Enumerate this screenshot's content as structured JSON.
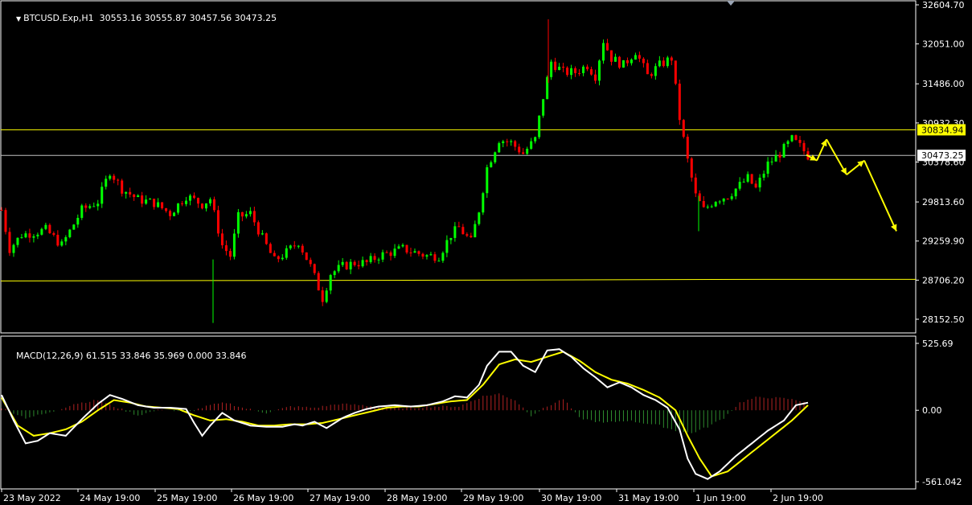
{
  "header": {
    "symbol_line": "BTCUSD.Exp,H1  30553.16 30555.87 30457.56 30473.25",
    "macd_line": "MACD(12,26,9) 61.515 33.846 35.969 0.000 33.846"
  },
  "colors": {
    "background": "#000000",
    "bull": "#00ff00",
    "bear": "#ff0000",
    "level_line": "#ffff00",
    "bid_line": "#c0c0c0",
    "macd_main": "#ffffff",
    "macd_signal": "#ffff00",
    "hist_pos": "#b22222",
    "hist_neg": "#2e8b2e",
    "forecast_arrow": "#ffff00"
  },
  "chart_data": [
    {
      "type": "candlestick",
      "symbol": "BTCUSD.Exp",
      "timeframe": "H1",
      "ohlc_last": {
        "open": 30553.16,
        "high": 30555.87,
        "low": 30457.56,
        "close": 30473.25
      },
      "y_ticks": [
        32604.7,
        32051.0,
        31486.0,
        30932.3,
        30378.6,
        29813.6,
        29259.9,
        28706.2,
        28152.5
      ],
      "ylim": [
        28050,
        32604.7
      ],
      "x_ticks": [
        "23 May 2022",
        "24 May 19:00",
        "25 May 19:00",
        "26 May 19:00",
        "27 May 19:00",
        "28 May 19:00",
        "29 May 19:00",
        "30 May 19:00",
        "31 May 19:00",
        "1 Jun 19:00",
        "2 Jun 19:00"
      ],
      "price_tags": [
        {
          "value": 30834.94,
          "label": "30834.94",
          "kind": "horizontal-level"
        },
        {
          "value": 30473.25,
          "label": "30473.25",
          "kind": "bid"
        }
      ],
      "support_line": 28706.2,
      "close_path": [
        [
          0,
          29700
        ],
        [
          2,
          29150
        ],
        [
          5,
          29350
        ],
        [
          8,
          29380
        ],
        [
          11,
          29420
        ],
        [
          15,
          29200
        ],
        [
          20,
          29700
        ],
        [
          24,
          29820
        ],
        [
          27,
          30250
        ],
        [
          30,
          30000
        ],
        [
          34,
          29850
        ],
        [
          38,
          29800
        ],
        [
          42,
          29650
        ],
        [
          46,
          29900
        ],
        [
          50,
          29780
        ],
        [
          52,
          29860
        ],
        [
          55,
          29200
        ],
        [
          57,
          29050
        ],
        [
          59,
          29600
        ],
        [
          62,
          29650
        ],
        [
          65,
          29300
        ],
        [
          68,
          28980
        ],
        [
          71,
          29100
        ],
        [
          74,
          29250
        ],
        [
          77,
          28900
        ],
        [
          80,
          28450
        ],
        [
          82,
          28800
        ],
        [
          85,
          28900
        ],
        [
          88,
          28950
        ],
        [
          91,
          28950
        ],
        [
          94,
          29050
        ],
        [
          97,
          29100
        ],
        [
          100,
          29150
        ],
        [
          103,
          29100
        ],
        [
          106,
          29050
        ],
        [
          109,
          29050
        ],
        [
          112,
          29350
        ],
        [
          114,
          29450
        ],
        [
          117,
          29250
        ],
        [
          119,
          29700
        ],
        [
          121,
          30300
        ],
        [
          124,
          30700
        ],
        [
          127,
          30650
        ],
        [
          130,
          30500
        ],
        [
          133,
          30700
        ],
        [
          135,
          31300
        ],
        [
          137,
          31800
        ],
        [
          140,
          31650
        ],
        [
          143,
          31650
        ],
        [
          146,
          31750
        ],
        [
          148,
          31600
        ],
        [
          150,
          32100
        ],
        [
          152,
          31850
        ],
        [
          155,
          31750
        ],
        [
          158,
          31950
        ],
        [
          161,
          31600
        ],
        [
          164,
          31750
        ],
        [
          167,
          31850
        ],
        [
          169,
          31000
        ],
        [
          171,
          30400
        ],
        [
          173,
          29900
        ],
        [
          175,
          29700
        ],
        [
          178,
          29850
        ],
        [
          181,
          29900
        ],
        [
          184,
          30050
        ],
        [
          186,
          30150
        ],
        [
          188,
          30000
        ],
        [
          191,
          30350
        ],
        [
          194,
          30500
        ],
        [
          197,
          30700
        ],
        [
          199,
          30600
        ],
        [
          201,
          30470
        ]
      ],
      "forecast_path": [
        [
          30480,
          30400
        ],
        [
          30500,
          30700
        ],
        [
          30550,
          30200
        ],
        [
          30600,
          30400
        ],
        [
          30640,
          29400
        ]
      ]
    },
    {
      "type": "macd",
      "name": "MACD(12,26,9)",
      "values": {
        "main": 61.515,
        "signal": 33.846,
        "histogram": 35.969,
        "extra1": 0.0,
        "extra2": 33.846
      },
      "y_ticks": [
        525.69,
        0.0,
        -561.042
      ],
      "ylim": [
        -561.042,
        525.69
      ],
      "main_path": [
        [
          0,
          120
        ],
        [
          3,
          -80
        ],
        [
          6,
          -260
        ],
        [
          9,
          -240
        ],
        [
          12,
          -180
        ],
        [
          16,
          -200
        ],
        [
          20,
          -70
        ],
        [
          24,
          50
        ],
        [
          27,
          120
        ],
        [
          30,
          90
        ],
        [
          34,
          40
        ],
        [
          38,
          20
        ],
        [
          42,
          20
        ],
        [
          46,
          10
        ],
        [
          48,
          -100
        ],
        [
          50,
          -200
        ],
        [
          52,
          -120
        ],
        [
          55,
          -20
        ],
        [
          58,
          -80
        ],
        [
          62,
          -120
        ],
        [
          66,
          -130
        ],
        [
          70,
          -130
        ],
        [
          73,
          -110
        ],
        [
          75,
          -120
        ],
        [
          78,
          -90
        ],
        [
          81,
          -140
        ],
        [
          85,
          -60
        ],
        [
          88,
          -20
        ],
        [
          91,
          10
        ],
        [
          94,
          30
        ],
        [
          98,
          40
        ],
        [
          102,
          30
        ],
        [
          106,
          40
        ],
        [
          110,
          70
        ],
        [
          113,
          110
        ],
        [
          116,
          100
        ],
        [
          119,
          200
        ],
        [
          121,
          350
        ],
        [
          124,
          460
        ],
        [
          127,
          460
        ],
        [
          130,
          350
        ],
        [
          133,
          300
        ],
        [
          136,
          470
        ],
        [
          139,
          480
        ],
        [
          142,
          420
        ],
        [
          145,
          330
        ],
        [
          148,
          260
        ],
        [
          151,
          180
        ],
        [
          154,
          220
        ],
        [
          157,
          180
        ],
        [
          160,
          120
        ],
        [
          163,
          80
        ],
        [
          166,
          20
        ],
        [
          169,
          -150
        ],
        [
          171,
          -380
        ],
        [
          173,
          -500
        ],
        [
          176,
          -540
        ],
        [
          179,
          -480
        ],
        [
          183,
          -360
        ],
        [
          187,
          -260
        ],
        [
          191,
          -160
        ],
        [
          195,
          -80
        ],
        [
          198,
          40
        ],
        [
          201,
          60
        ]
      ],
      "signal_path": [
        [
          0,
          100
        ],
        [
          4,
          -120
        ],
        [
          8,
          -200
        ],
        [
          12,
          -180
        ],
        [
          16,
          -150
        ],
        [
          20,
          -90
        ],
        [
          24,
          0
        ],
        [
          28,
          80
        ],
        [
          32,
          60
        ],
        [
          36,
          30
        ],
        [
          40,
          20
        ],
        [
          44,
          10
        ],
        [
          48,
          -40
        ],
        [
          52,
          -80
        ],
        [
          56,
          -70
        ],
        [
          60,
          -90
        ],
        [
          64,
          -120
        ],
        [
          68,
          -120
        ],
        [
          72,
          -110
        ],
        [
          76,
          -110
        ],
        [
          80,
          -100
        ],
        [
          84,
          -70
        ],
        [
          88,
          -40
        ],
        [
          92,
          -10
        ],
        [
          96,
          20
        ],
        [
          100,
          30
        ],
        [
          104,
          30
        ],
        [
          108,
          50
        ],
        [
          112,
          70
        ],
        [
          116,
          80
        ],
        [
          120,
          200
        ],
        [
          124,
          360
        ],
        [
          128,
          400
        ],
        [
          132,
          380
        ],
        [
          136,
          420
        ],
        [
          140,
          460
        ],
        [
          144,
          390
        ],
        [
          148,
          300
        ],
        [
          152,
          240
        ],
        [
          156,
          210
        ],
        [
          160,
          160
        ],
        [
          164,
          100
        ],
        [
          168,
          0
        ],
        [
          171,
          -200
        ],
        [
          174,
          -380
        ],
        [
          177,
          -520
        ],
        [
          181,
          -480
        ],
        [
          185,
          -380
        ],
        [
          189,
          -280
        ],
        [
          193,
          -180
        ],
        [
          197,
          -80
        ],
        [
          201,
          40
        ]
      ],
      "histogram_path": [
        [
          0,
          20
        ],
        [
          6,
          -60
        ],
        [
          12,
          -20
        ],
        [
          18,
          50
        ],
        [
          24,
          80
        ],
        [
          28,
          30
        ],
        [
          34,
          -40
        ],
        [
          40,
          10
        ],
        [
          46,
          -20
        ],
        [
          52,
          40
        ],
        [
          56,
          60
        ],
        [
          60,
          20
        ],
        [
          66,
          -20
        ],
        [
          72,
          30
        ],
        [
          78,
          20
        ],
        [
          84,
          50
        ],
        [
          90,
          40
        ],
        [
          96,
          20
        ],
        [
          102,
          20
        ],
        [
          108,
          30
        ],
        [
          114,
          30
        ],
        [
          120,
          110
        ],
        [
          124,
          130
        ],
        [
          128,
          80
        ],
        [
          132,
          -40
        ],
        [
          136,
          30
        ],
        [
          140,
          90
        ],
        [
          144,
          -60
        ],
        [
          150,
          -100
        ],
        [
          156,
          -80
        ],
        [
          160,
          -100
        ],
        [
          164,
          -120
        ],
        [
          168,
          -160
        ],
        [
          172,
          -180
        ],
        [
          176,
          -130
        ],
        [
          180,
          -60
        ],
        [
          184,
          60
        ],
        [
          188,
          100
        ],
        [
          192,
          100
        ],
        [
          196,
          90
        ],
        [
          200,
          70
        ]
      ]
    }
  ]
}
